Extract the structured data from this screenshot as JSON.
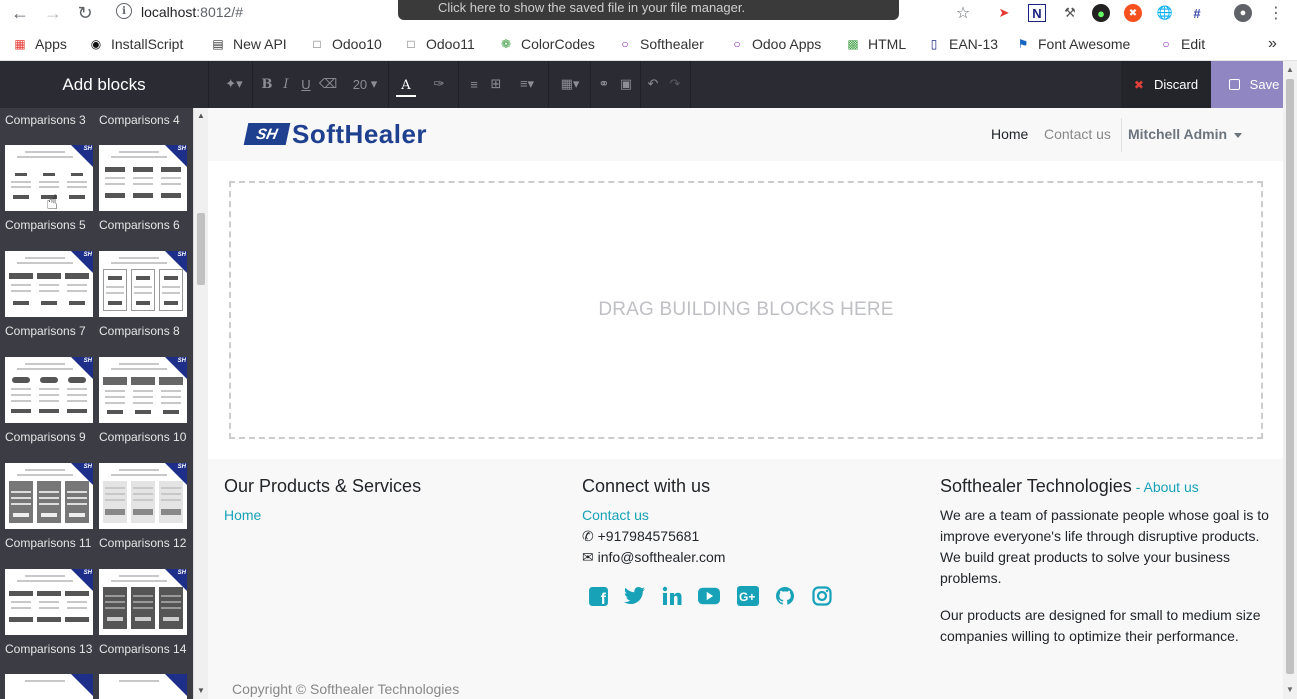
{
  "browser": {
    "url_host": "localhost",
    "url_rest": ":8012/#",
    "toast": "Click here to show the saved file in your file manager.",
    "bookmarks": [
      "Apps",
      "InstallScript",
      "New API",
      "Odoo10",
      "Odoo11",
      "ColorCodes",
      "Softhealer",
      "Odoo Apps",
      "HTML",
      "EAN-13",
      "Font Awesome",
      "Edit"
    ]
  },
  "toolbar": {
    "sidebar_title": "Add blocks",
    "font_size": "20",
    "discard_label": "Discard",
    "save_label": "Save"
  },
  "sidebar": {
    "blocks": [
      "Comparisons 3",
      "Comparisons 4",
      "Comparisons 5",
      "Comparisons 6",
      "Comparisons 7",
      "Comparisons 8",
      "Comparisons 9",
      "Comparisons 10",
      "Comparisons 11",
      "Comparisons 12",
      "Comparisons 13",
      "Comparisons 14"
    ]
  },
  "site": {
    "logo_mark": "SH",
    "logo_text": "SoftHealer",
    "nav": {
      "home": "Home",
      "contact": "Contact us",
      "user": "Mitchell Admin"
    },
    "dropzone_text": "DRAG BUILDING BLOCKS HERE"
  },
  "footer": {
    "col1_title": "Our Products & Services",
    "col1_link": "Home",
    "col2_title": "Connect with us",
    "col2_link": "Contact us",
    "phone": "+917984575681",
    "email": "info@softhealer.com",
    "col3_title": "Softhealer Technologies",
    "col3_title_sep": " - ",
    "col3_link": "About us",
    "about_p1": "We are a team of passionate people whose goal is to improve everyone's life through disruptive products. We build great products to solve your business problems.",
    "about_p2": "Our products are designed for small to medium size companies willing to optimize their performance.",
    "copyright": "Copyright © Softhealer Technologies"
  },
  "colors": {
    "accent": "#17a2b8",
    "save": "#8f86c2",
    "toolbar": "#2b2c33",
    "sidebar": "#3b3c44",
    "logo": "#1f3f8f"
  }
}
